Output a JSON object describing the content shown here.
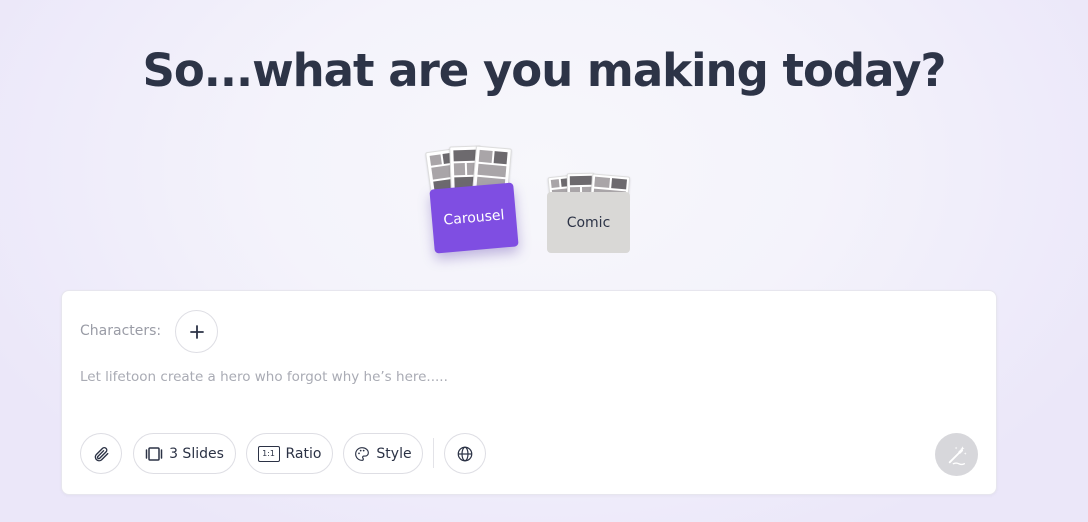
{
  "heading": "So...what are you making today?",
  "modes": [
    {
      "label": "Carousel",
      "selected": true,
      "color": "#7f4ee2"
    },
    {
      "label": "Comic",
      "selected": false,
      "color": "#d9d8d6"
    }
  ],
  "composer": {
    "characters_label": "Characters:",
    "prompt_placeholder": "Let lifetoon create a hero who forgot why he’s here.....",
    "prompt_value": "",
    "toolbar": {
      "slides_label": "3 Slides",
      "ratio_label": "Ratio",
      "ratio_badge": "1:1",
      "style_label": "Style"
    },
    "icons": {
      "add_character": "plus-icon",
      "attach": "paperclip-icon",
      "slides": "slides-icon",
      "style": "palette-icon",
      "language": "globe-icon",
      "generate": "magic-wand-icon"
    }
  }
}
